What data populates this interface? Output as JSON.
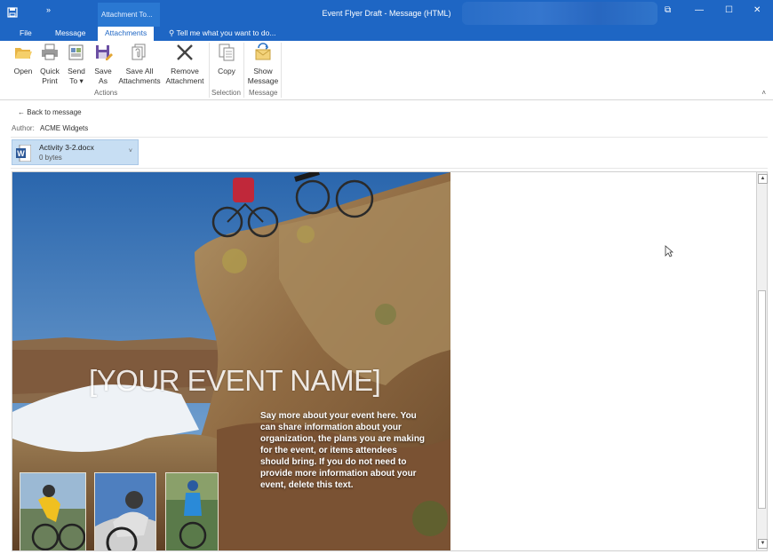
{
  "titlebar": {
    "context_tab": "Attachment To...",
    "title": "Event Flyer Draft - Message (HTML)",
    "more_glyph": "»",
    "restore_glyph": "⧉",
    "minimize_glyph": "—",
    "maximize_glyph": "☐",
    "close_glyph": "✕"
  },
  "tabs": {
    "file": "File",
    "message": "Message",
    "attachments": "Attachments",
    "tell_me": "Tell me what you want to do..."
  },
  "ribbon": {
    "open": "Open",
    "quick_print": [
      "Quick",
      "Print"
    ],
    "send_to": [
      "Send",
      "To ▾"
    ],
    "save_as": [
      "Save",
      "As"
    ],
    "save_all": [
      "Save All",
      "Attachments"
    ],
    "remove": [
      "Remove",
      "Attachment"
    ],
    "copy": "Copy",
    "show_message": [
      "Show",
      "Message"
    ],
    "groups": {
      "actions": "Actions",
      "selection": "Selection",
      "message": "Message"
    },
    "collapse_glyph": "˄"
  },
  "header": {
    "back": "Back to message",
    "back_arrow": "←",
    "author_label": "Author:",
    "author_value": "ACME Widgets"
  },
  "attachment": {
    "name": "Activity 3-2.docx",
    "size": "0 bytes",
    "chevron": "˅"
  },
  "flyer": {
    "event_name": "[YOUR EVENT NAME]",
    "description": "Say more about your event here. You can share information about your organization, the plans you are making for the event, or items attendees should bring. If you do not need to provide  more information about your event, delete this text."
  },
  "scroll": {
    "up": "▲",
    "down": "▼"
  },
  "colors": {
    "accent": "#1e66c4",
    "attachment_bg": "#c7def3"
  }
}
